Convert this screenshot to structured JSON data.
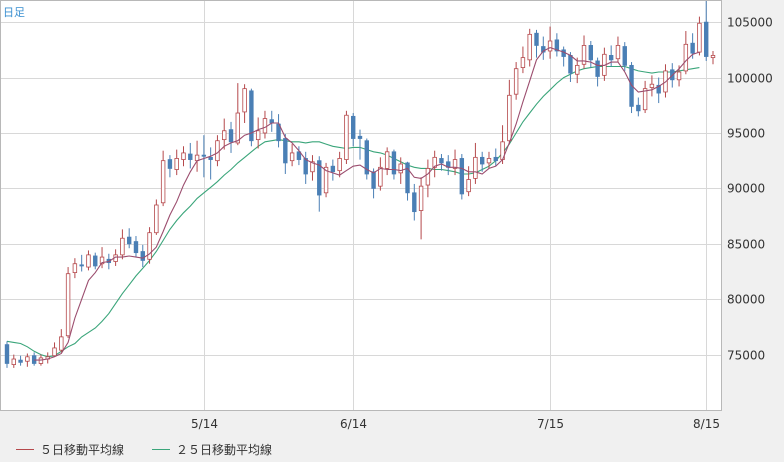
{
  "corner_label": "日足",
  "legend": {
    "ma5_label": "５日移動平均線",
    "ma25_label": "２５日移動平均線"
  },
  "colors": {
    "up": "#b5484b",
    "down": "#4a7fb5",
    "ma5": "#9b4d6e",
    "ma25": "#3aa57a",
    "grid": "#d8d8d8",
    "plot_bg": "#ffffff",
    "page_bg": "#f0f0f0"
  },
  "chart_data": {
    "type": "candlestick",
    "title": "",
    "ylim": [
      70000,
      107000
    ],
    "y_ticks": [
      75000,
      80000,
      85000,
      90000,
      95000,
      100000,
      105000
    ],
    "y_tick_labels": [
      "75000",
      "80000",
      "85000",
      "90000",
      "95000",
      "100000",
      "105000"
    ],
    "x_ticks": [
      {
        "label": "5/14",
        "index": 29
      },
      {
        "label": "6/14",
        "index": 51
      },
      {
        "label": "7/15",
        "index": 80
      },
      {
        "label": "8/15",
        "index": 103
      }
    ],
    "ohlc": [
      [
        75900,
        74200,
        76200,
        73800
      ],
      [
        74100,
        74600,
        75000,
        73800
      ],
      [
        74500,
        74300,
        74900,
        74000
      ],
      [
        74400,
        74800,
        75100,
        73900
      ],
      [
        74900,
        74200,
        75200,
        74000
      ],
      [
        74200,
        74700,
        75000,
        74000
      ],
      [
        74600,
        74800,
        75200,
        74200
      ],
      [
        74900,
        75600,
        76100,
        74800
      ],
      [
        75400,
        76600,
        77300,
        75200
      ],
      [
        76700,
        82300,
        82900,
        76500
      ],
      [
        82400,
        83200,
        83700,
        81900
      ],
      [
        83100,
        83000,
        84000,
        82500
      ],
      [
        82900,
        84000,
        84400,
        82600
      ],
      [
        83900,
        83000,
        84200,
        82700
      ],
      [
        83200,
        83800,
        84700,
        82800
      ],
      [
        83600,
        83300,
        84100,
        82700
      ],
      [
        83400,
        84000,
        84500,
        83000
      ],
      [
        84000,
        85500,
        86300,
        83600
      ],
      [
        85600,
        85000,
        86400,
        84600
      ],
      [
        85200,
        84200,
        85700,
        83800
      ],
      [
        84300,
        83500,
        84900,
        82900
      ],
      [
        83600,
        86000,
        86500,
        83200
      ],
      [
        86000,
        88500,
        89000,
        85800
      ],
      [
        88700,
        92500,
        93400,
        88400
      ],
      [
        92600,
        91800,
        93000,
        91000
      ],
      [
        91700,
        92700,
        93500,
        91200
      ],
      [
        92600,
        93200,
        93800,
        92000
      ],
      [
        93100,
        92600,
        94100,
        91800
      ],
      [
        92500,
        93000,
        94300,
        91500
      ],
      [
        93000,
        92900,
        94800,
        91000
      ],
      [
        92800,
        92600,
        93700,
        90800
      ],
      [
        92500,
        94300,
        94800,
        92000
      ],
      [
        94400,
        95200,
        96300,
        93500
      ],
      [
        95300,
        94200,
        96000,
        93200
      ],
      [
        94100,
        96800,
        99500,
        93900
      ],
      [
        96900,
        99000,
        99400,
        95900
      ],
      [
        98800,
        94300,
        99000,
        93800
      ],
      [
        94400,
        95200,
        96400,
        93600
      ],
      [
        95000,
        96300,
        97000,
        94500
      ],
      [
        96200,
        95900,
        97000,
        95100
      ],
      [
        95800,
        94300,
        96700,
        93700
      ],
      [
        94500,
        92300,
        94900,
        91300
      ],
      [
        92500,
        93200,
        94000,
        92000
      ],
      [
        93300,
        92600,
        93800,
        92100
      ],
      [
        92700,
        91300,
        93300,
        90400
      ],
      [
        91500,
        92400,
        93000,
        90700
      ],
      [
        92500,
        89400,
        92900,
        87900
      ],
      [
        89600,
        91900,
        92300,
        89200
      ],
      [
        92000,
        91500,
        92600,
        90700
      ],
      [
        91600,
        92700,
        93300,
        91000
      ],
      [
        92600,
        96600,
        97000,
        92200
      ],
      [
        96500,
        94500,
        96800,
        93800
      ],
      [
        94700,
        94500,
        95300,
        92600
      ],
      [
        94300,
        91300,
        94500,
        90800
      ],
      [
        91500,
        90000,
        91800,
        89100
      ],
      [
        90200,
        91900,
        92800,
        89800
      ],
      [
        91800,
        93300,
        93700,
        91200
      ],
      [
        93300,
        91300,
        93500,
        90800
      ],
      [
        91400,
        92200,
        92800,
        90400
      ],
      [
        92300,
        89600,
        92400,
        88900
      ],
      [
        89600,
        87900,
        90400,
        87100
      ],
      [
        88000,
        90200,
        91000,
        85400
      ],
      [
        90300,
        91800,
        92600,
        89200
      ],
      [
        91900,
        92800,
        93400,
        91000
      ],
      [
        92700,
        92300,
        93100,
        91600
      ],
      [
        92400,
        91900,
        93000,
        91200
      ],
      [
        91800,
        92600,
        93500,
        91200
      ],
      [
        92700,
        89500,
        93100,
        89000
      ],
      [
        89700,
        90800,
        92000,
        89300
      ],
      [
        90900,
        92800,
        94100,
        90400
      ],
      [
        92800,
        92200,
        93300,
        91500
      ],
      [
        92300,
        92700,
        93300,
        91800
      ],
      [
        92800,
        92500,
        93600,
        92000
      ],
      [
        92600,
        94200,
        95700,
        92200
      ],
      [
        94300,
        98400,
        99800,
        94000
      ],
      [
        98500,
        100800,
        101400,
        98000
      ],
      [
        100900,
        101800,
        102800,
        100400
      ],
      [
        101600,
        103900,
        104400,
        101000
      ],
      [
        104000,
        102900,
        104300,
        101800
      ],
      [
        102800,
        102300,
        103700,
        101600
      ],
      [
        102400,
        103300,
        104600,
        101700
      ],
      [
        103400,
        102400,
        104000,
        101900
      ],
      [
        102500,
        101900,
        102800,
        101000
      ],
      [
        102000,
        100400,
        102300,
        99600
      ],
      [
        100300,
        101100,
        101800,
        99500
      ],
      [
        101200,
        102900,
        103800,
        100800
      ],
      [
        102900,
        101600,
        103300,
        100900
      ],
      [
        101500,
        100100,
        101800,
        99200
      ],
      [
        100200,
        102100,
        102700,
        99700
      ],
      [
        102000,
        101600,
        102900,
        101000
      ],
      [
        101700,
        102900,
        103700,
        101400
      ],
      [
        102800,
        101100,
        103200,
        100600
      ],
      [
        101100,
        97400,
        101400,
        96800
      ],
      [
        97500,
        97000,
        98200,
        96500
      ],
      [
        97100,
        99000,
        99700,
        96800
      ],
      [
        99100,
        99400,
        100200,
        98300
      ],
      [
        99300,
        98600,
        100000,
        97700
      ],
      [
        98700,
        100600,
        101200,
        98200
      ],
      [
        100700,
        99800,
        101300,
        99100
      ],
      [
        99800,
        100500,
        101100,
        99200
      ],
      [
        100600,
        103000,
        104200,
        100300
      ],
      [
        103100,
        102200,
        104000,
        101700
      ],
      [
        102300,
        104900,
        105500,
        102000
      ],
      [
        105000,
        101900,
        107000,
        101500
      ],
      [
        101800,
        102000,
        102400,
        101200
      ]
    ],
    "series": [
      {
        "name": "５日移動平均線",
        "values": [
          null,
          null,
          null,
          null,
          74500,
          74500,
          74600,
          74800,
          75100,
          76100,
          78300,
          80000,
          81700,
          82400,
          83300,
          83400,
          83800,
          83800,
          83900,
          83800,
          83700,
          84100,
          84700,
          86100,
          87600,
          88800,
          90300,
          91500,
          92500,
          92700,
          92900,
          93200,
          93800,
          94100,
          94300,
          94800,
          95000,
          95300,
          95500,
          95900,
          95900,
          94600,
          94100,
          93400,
          92600,
          92300,
          92100,
          91600,
          91400,
          91200,
          91600,
          92000,
          92100,
          91700,
          91400,
          91800,
          91700,
          91700,
          91600,
          91800,
          91000,
          90900,
          91300,
          92000,
          92200,
          91900,
          91900,
          91800,
          91500,
          91500,
          91300,
          91800,
          92000,
          92600,
          94100,
          95800,
          97800,
          99700,
          101600,
          102400,
          102700,
          102500,
          102300,
          102000,
          101500,
          101500,
          101400,
          101100,
          101100,
          101400,
          101400,
          100500,
          99300,
          98700,
          98800,
          98900,
          99200,
          99600,
          100200,
          100800,
          101500,
          102100,
          102300
        ]
      },
      {
        "name": "２５日移動平均線",
        "values": [
          76200,
          76100,
          76000,
          75700,
          75300,
          75000,
          74800,
          74900,
          75300,
          75700,
          76000,
          76600,
          77000,
          77400,
          78000,
          78700,
          79600,
          80500,
          81300,
          82100,
          82800,
          83500,
          84300,
          85300,
          86300,
          87100,
          87800,
          88400,
          89100,
          89600,
          90100,
          90600,
          91200,
          91700,
          92300,
          92800,
          93300,
          93800,
          94200,
          94300,
          94400,
          94300,
          94200,
          94200,
          94100,
          94200,
          94200,
          94000,
          93800,
          93700,
          93600,
          93700,
          93700,
          93500,
          93300,
          93200,
          93000,
          92700,
          92400,
          92100,
          91900,
          91800,
          91800,
          91700,
          91700,
          91600,
          91500,
          91300,
          91300,
          91400,
          91700,
          92000,
          92500,
          93200,
          94000,
          95000,
          96000,
          96800,
          97600,
          98300,
          98900,
          99500,
          100000,
          100300,
          100600,
          100800,
          100900,
          101000,
          101000,
          101000,
          101000,
          101000,
          100800,
          100600,
          100500,
          100400,
          100500,
          100500,
          100500,
          100600,
          100700,
          100800,
          100900
        ]
      }
    ]
  }
}
